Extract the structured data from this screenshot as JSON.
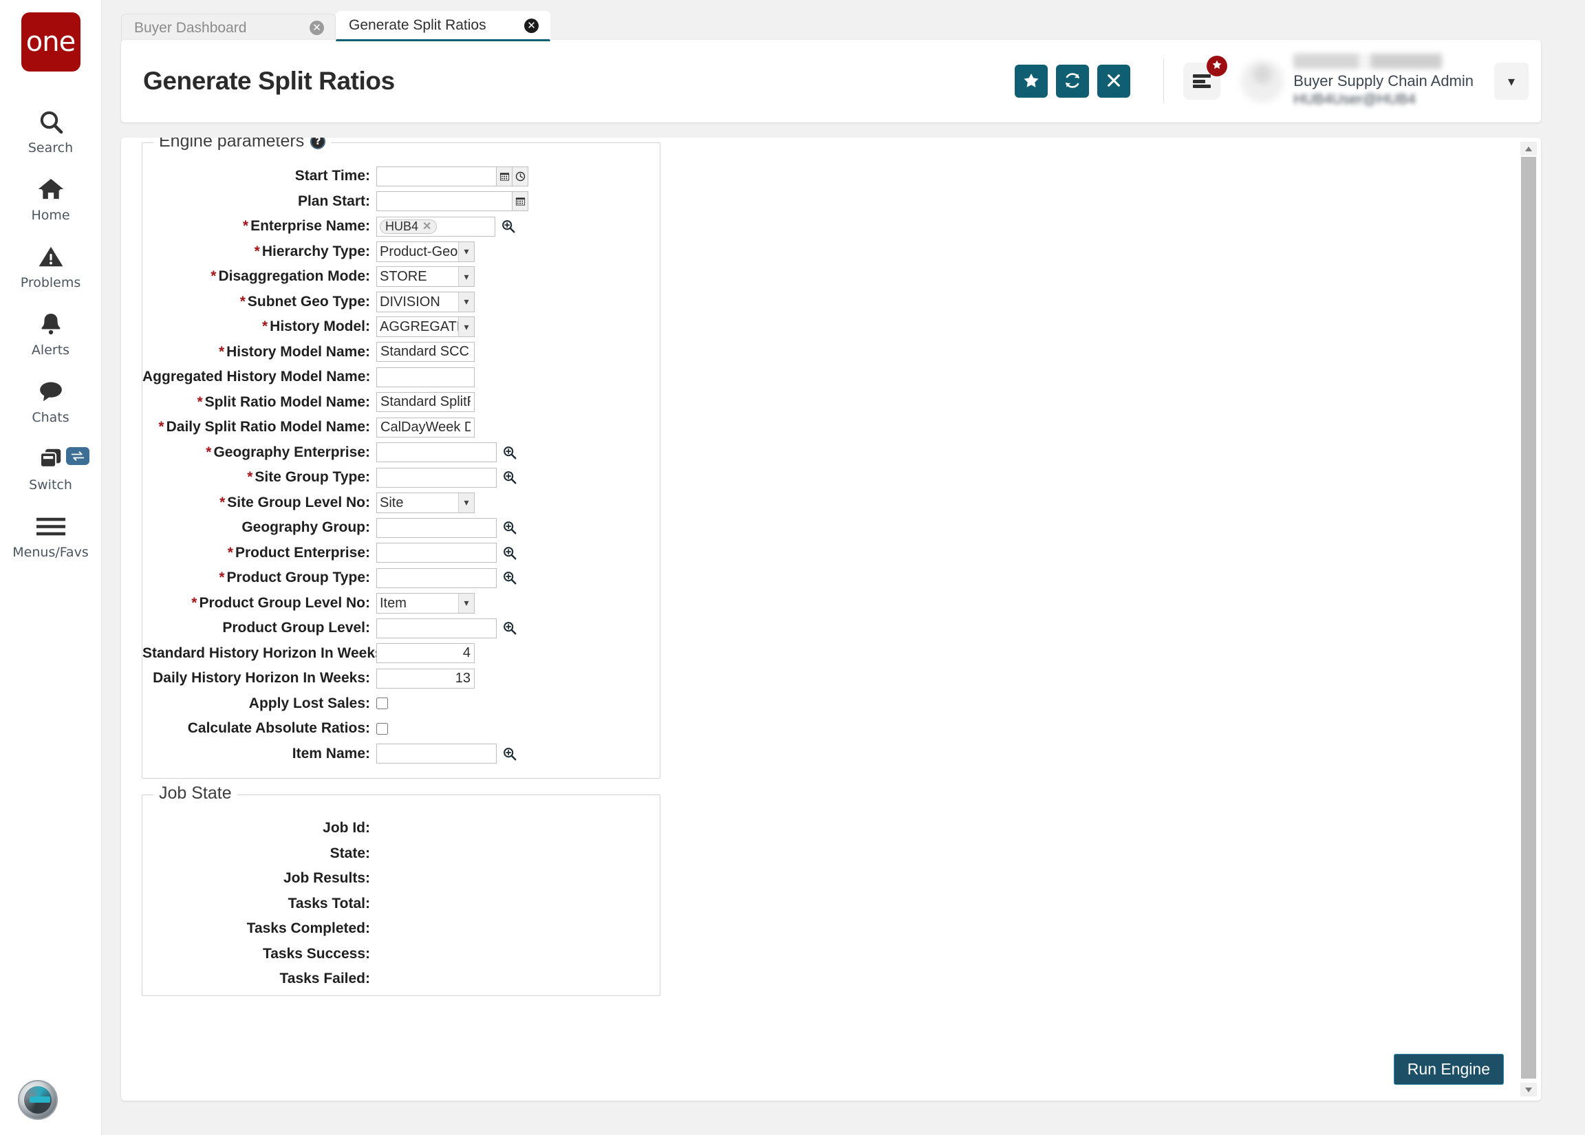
{
  "brand": {
    "logo_text": "one",
    "logo_color": "#a50a0a"
  },
  "theme": {
    "accent": "#0f5e72",
    "required_star": "#a4161a",
    "badge_red": "#9c0d12",
    "run_button": "#1d4f66"
  },
  "sidebar": {
    "items": [
      {
        "label": "Search",
        "icon": "search-icon"
      },
      {
        "label": "Home",
        "icon": "home-icon"
      },
      {
        "label": "Problems",
        "icon": "warning-triangle-icon"
      },
      {
        "label": "Alerts",
        "icon": "bell-icon"
      },
      {
        "label": "Chats",
        "icon": "chat-bubble-icon"
      },
      {
        "label": "Switch",
        "icon": "windows-stack-icon",
        "badge_icon": "swap-arrows-icon"
      },
      {
        "label": "Menus/Favs",
        "icon": "hamburger-icon"
      }
    ],
    "assistant_icon": "robot-avatar-icon"
  },
  "tabs": [
    {
      "label": "Buyer Dashboard",
      "active": false,
      "close_icon": "close-circle-icon"
    },
    {
      "label": "Generate Split Ratios",
      "active": true,
      "close_icon": "close-circle-icon"
    }
  ],
  "header": {
    "title": "Generate Split Ratios",
    "actions": [
      {
        "name": "favorite-button",
        "icon": "star-icon"
      },
      {
        "name": "refresh-button",
        "icon": "refresh-icon"
      },
      {
        "name": "close-button",
        "icon": "x-icon"
      }
    ],
    "menu_button": {
      "icon": "hamburger-menu-icon",
      "badge_icon": "star-icon"
    },
    "user": {
      "name_redacted": "",
      "role": "Buyer Supply Chain Admin",
      "email": "HUB4User@HUB4",
      "caret_icon": "chevron-down-icon"
    }
  },
  "engine_section": {
    "legend": "Engine parameters",
    "help_icon": "help-circle-icon",
    "fields": [
      {
        "label": "Start Time:",
        "required": false,
        "type": "datetime",
        "value": "",
        "icons": [
          "calendar-icon",
          "clock-icon"
        ]
      },
      {
        "label": "Plan Start:",
        "required": false,
        "type": "date",
        "value": "",
        "icons": [
          "calendar-icon"
        ]
      },
      {
        "label": "Enterprise Name:",
        "required": true,
        "type": "chips",
        "chips": [
          "HUB4"
        ],
        "icons": [
          "search-plus-icon"
        ]
      },
      {
        "label": "Hierarchy Type:",
        "required": true,
        "type": "select",
        "value": "Product-Geo",
        "options": [
          "Product-Geo"
        ]
      },
      {
        "label": "Disaggregation Mode:",
        "required": true,
        "type": "select",
        "value": "STORE",
        "options": [
          "STORE"
        ]
      },
      {
        "label": "Subnet Geo Type:",
        "required": true,
        "type": "select",
        "value": "DIVISION",
        "options": [
          "DIVISION"
        ]
      },
      {
        "label": "History Model:",
        "required": true,
        "type": "select",
        "value": "AGGREGATED_POS",
        "options": [
          "AGGREGATED_POS"
        ]
      },
      {
        "label": "History Model Name:",
        "required": true,
        "type": "text",
        "value": "Standard SCC.StorePOS"
      },
      {
        "label": "Aggregated History Model Name:",
        "required": false,
        "type": "text",
        "value": ""
      },
      {
        "label": "Split Ratio Model Name:",
        "required": true,
        "type": "text",
        "value": "Standard SplitRatio"
      },
      {
        "label": "Daily Split Ratio Model Name:",
        "required": true,
        "type": "text",
        "value": "CalDayWeek Division Sp"
      },
      {
        "label": "Geography Enterprise:",
        "required": true,
        "type": "lookup",
        "value": "",
        "icons": [
          "search-plus-icon"
        ]
      },
      {
        "label": "Site Group Type:",
        "required": true,
        "type": "lookup",
        "value": "",
        "icons": [
          "search-plus-icon"
        ]
      },
      {
        "label": "Site Group Level No:",
        "required": true,
        "type": "select",
        "value": "Site",
        "options": [
          "Site"
        ]
      },
      {
        "label": "Geography Group:",
        "required": false,
        "type": "lookup",
        "value": "",
        "icons": [
          "search-plus-icon"
        ]
      },
      {
        "label": "Product Enterprise:",
        "required": true,
        "type": "lookup",
        "value": "",
        "icons": [
          "search-plus-icon"
        ]
      },
      {
        "label": "Product Group Type:",
        "required": true,
        "type": "lookup",
        "value": "",
        "icons": [
          "search-plus-icon"
        ]
      },
      {
        "label": "Product Group Level No:",
        "required": true,
        "type": "select",
        "value": "Item",
        "options": [
          "Item"
        ]
      },
      {
        "label": "Product Group Level:",
        "required": false,
        "type": "lookup",
        "value": "",
        "icons": [
          "search-plus-icon"
        ]
      },
      {
        "label": "Standard History Horizon In Weeks:",
        "required": false,
        "type": "number",
        "value": "4"
      },
      {
        "label": "Daily History Horizon In Weeks:",
        "required": false,
        "type": "number",
        "value": "13"
      },
      {
        "label": "Apply Lost Sales:",
        "required": false,
        "type": "checkbox",
        "checked": false
      },
      {
        "label": "Calculate Absolute Ratios:",
        "required": false,
        "type": "checkbox",
        "checked": false
      },
      {
        "label": "Item Name:",
        "required": false,
        "type": "lookup",
        "value": "",
        "icons": [
          "search-plus-icon"
        ]
      }
    ]
  },
  "job_section": {
    "legend": "Job State",
    "fields": [
      {
        "label": "Job Id:",
        "value": ""
      },
      {
        "label": "State:",
        "value": ""
      },
      {
        "label": "Job Results:",
        "value": ""
      },
      {
        "label": "Tasks Total:",
        "value": ""
      },
      {
        "label": "Tasks Completed:",
        "value": ""
      },
      {
        "label": "Tasks Success:",
        "value": ""
      },
      {
        "label": "Tasks Failed:",
        "value": ""
      }
    ]
  },
  "footer": {
    "run_label": "Run Engine"
  },
  "scrollbar": {
    "up_icon": "caret-up-icon",
    "down_icon": "caret-down-icon"
  }
}
